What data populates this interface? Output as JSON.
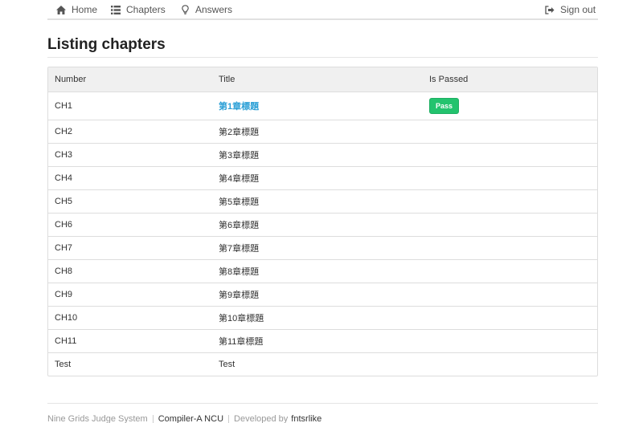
{
  "nav": {
    "home": {
      "label": "Home",
      "icon": "home-icon"
    },
    "chapters": {
      "label": "Chapters",
      "icon": "list-icon"
    },
    "answers": {
      "label": "Answers",
      "icon": "lightbulb-icon"
    },
    "signout": {
      "label": "Sign out",
      "icon": "sign-out-icon"
    }
  },
  "page": {
    "title": "Listing chapters"
  },
  "table": {
    "headers": [
      "Number",
      "Title",
      "Is Passed"
    ],
    "rows": [
      {
        "number": "CH1",
        "title": "第1章標題",
        "passed": "Pass"
      },
      {
        "number": "CH2",
        "title": "第2章標題",
        "passed": ""
      },
      {
        "number": "CH3",
        "title": "第3章標題",
        "passed": ""
      },
      {
        "number": "CH4",
        "title": "第4章標題",
        "passed": ""
      },
      {
        "number": "CH5",
        "title": "第5章標題",
        "passed": ""
      },
      {
        "number": "CH6",
        "title": "第6章標題",
        "passed": ""
      },
      {
        "number": "CH7",
        "title": "第7章標題",
        "passed": ""
      },
      {
        "number": "CH8",
        "title": "第8章標題",
        "passed": ""
      },
      {
        "number": "CH9",
        "title": "第9章標題",
        "passed": ""
      },
      {
        "number": "CH10",
        "title": "第10章標題",
        "passed": ""
      },
      {
        "number": "CH11",
        "title": "第11章標題",
        "passed": ""
      },
      {
        "number": "Test",
        "title": "Test",
        "passed": ""
      }
    ]
  },
  "footer": {
    "system": "Nine Grids Judge System",
    "course": "Compiler-A NCU",
    "developed_prefix": "Developed by",
    "developer": "fntsrlike"
  },
  "colors": {
    "accent_link": "#2a9fd6",
    "pass_badge": "#23c36e"
  }
}
